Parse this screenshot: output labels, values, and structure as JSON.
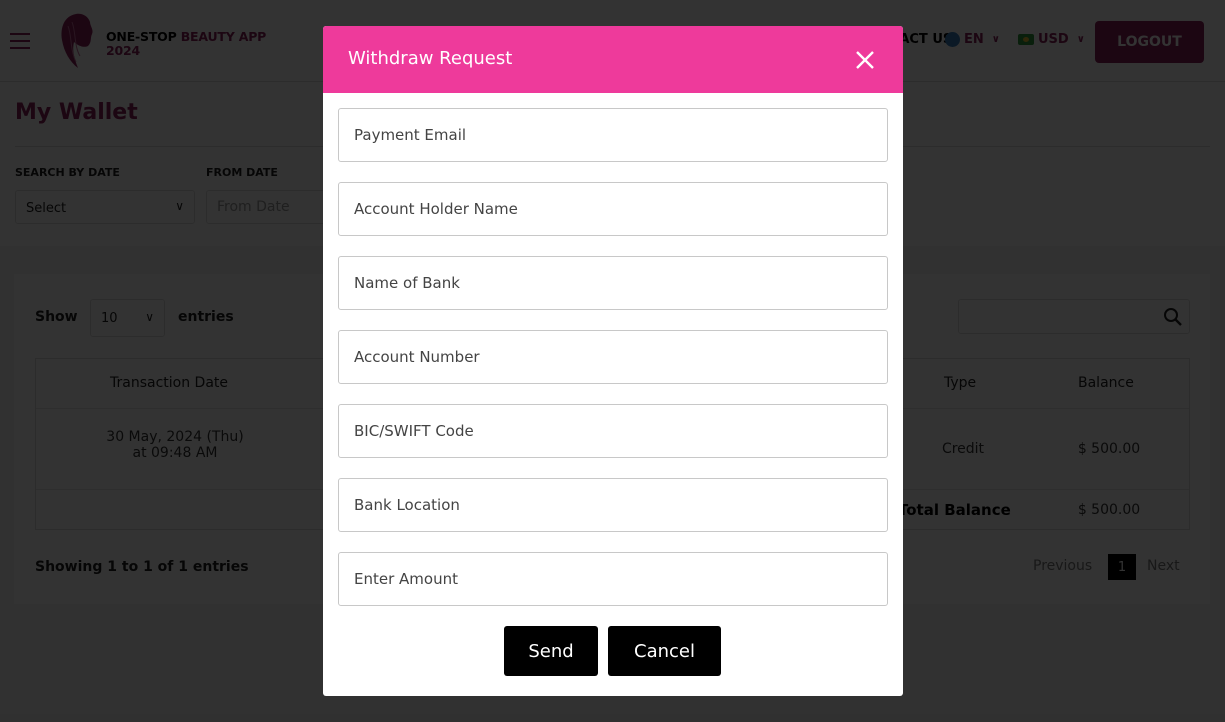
{
  "header": {
    "brand_part1": "ONE-STOP",
    "brand_part2": "BEAUTY APP",
    "brand_line2": "2024",
    "contact_label": "CONTACT US",
    "language": "EN",
    "currency": "USD",
    "logout_label": "LOGOUT"
  },
  "wallet": {
    "title": "My Wallet",
    "filters": {
      "search_by_date_label": "SEARCH BY DATE",
      "search_by_date_value": "Select",
      "from_date_label": "FROM DATE",
      "from_date_placeholder": "From Date"
    },
    "table_controls": {
      "show_label": "Show",
      "page_size": "10",
      "entries_label": "entries"
    },
    "columns": [
      "Transaction Date",
      "Type",
      "Balance"
    ],
    "rows": [
      {
        "date_line1": "30 May, 2024 (Thu)",
        "date_line2": "at 09:48 AM",
        "type": "Credit",
        "balance": "$ 500.00"
      }
    ],
    "total": {
      "label": "Total Balance",
      "value": "$ 500.00"
    },
    "pagination": {
      "summary": "Showing 1 to 1 of 1 entries",
      "previous": "Previous",
      "current_page": "1",
      "next": "Next"
    }
  },
  "modal": {
    "title": "Withdraw Request",
    "fields": [
      {
        "name": "payment-email",
        "placeholder": "Payment Email",
        "value": ""
      },
      {
        "name": "account-holder-name",
        "placeholder": "Account Holder Name",
        "value": ""
      },
      {
        "name": "bank-name",
        "placeholder": "Name of Bank",
        "value": ""
      },
      {
        "name": "account-number",
        "placeholder": "Account Number",
        "value": ""
      },
      {
        "name": "bic-swift-code",
        "placeholder": "BIC/SWIFT Code",
        "value": ""
      },
      {
        "name": "bank-location",
        "placeholder": "Bank Location",
        "value": ""
      },
      {
        "name": "amount",
        "placeholder": "Enter Amount",
        "value": ""
      }
    ],
    "send_label": "Send",
    "cancel_label": "Cancel"
  },
  "colors": {
    "brand": "#8e1e5a",
    "modal_header": "#ee3a9b",
    "button": "#000000"
  }
}
